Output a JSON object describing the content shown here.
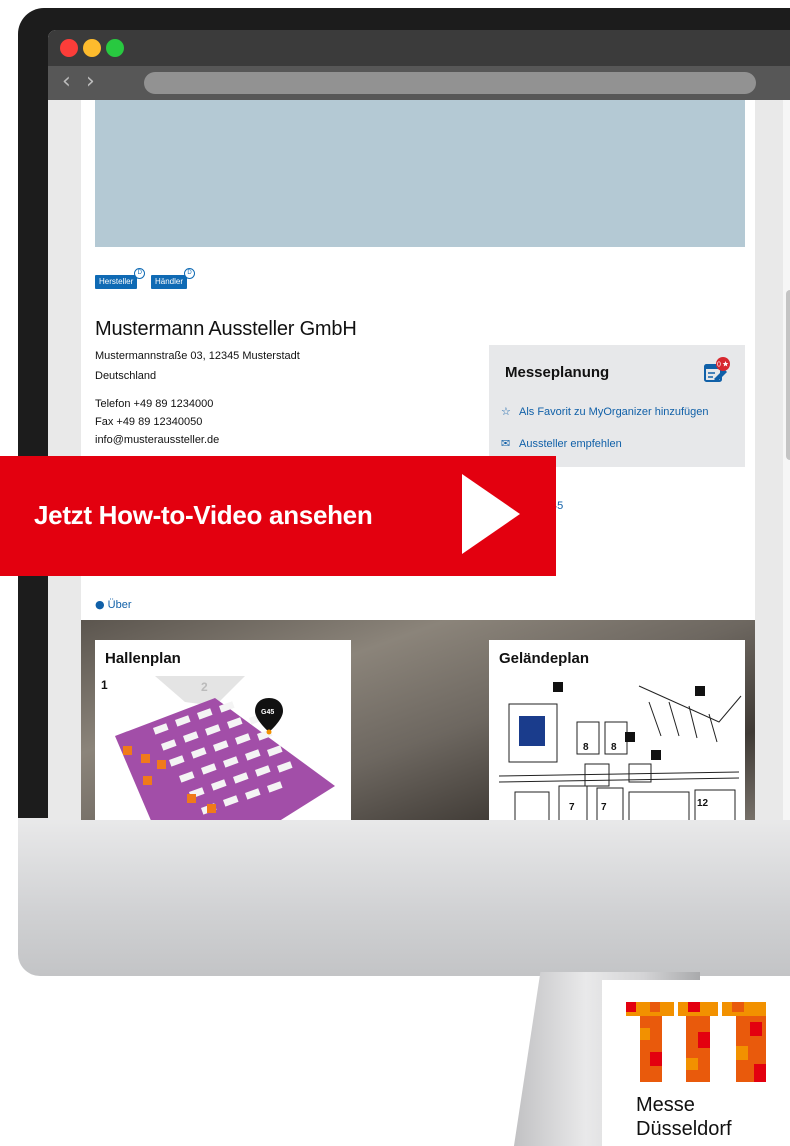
{
  "page": {
    "tags": [
      {
        "label": "Hersteller",
        "badge": "D"
      },
      {
        "label": "Händler",
        "badge": "D"
      }
    ],
    "company_name": "Mustermann Aussteller GmbH",
    "address_line1": "Mustermannstraße 03, 12345 Musterstadt",
    "address_line2": "Deutschland",
    "phone": "Telefon +49 89 1234000",
    "fax": "Fax +49 89 12340050",
    "email": "info@musteraussteller.de",
    "partial_stand": "45",
    "partial_link": "Über"
  },
  "planning": {
    "title": "Messeplanung",
    "badge": "0",
    "favorite_link": "Als Favorit zu MyOrganizer hinzufügen",
    "recommend_link": "Aussteller empfehlen",
    "favorite_icon": "star-outline-icon",
    "recommend_icon": "envelope-icon"
  },
  "maps": {
    "hall_title": "Hallenplan",
    "hall_number": "1",
    "hall_number_2": "2",
    "pin_label": "G45",
    "site_title": "Geländeplan"
  },
  "cta": {
    "text": "Jetzt How-to-Video ansehen"
  },
  "logo": {
    "line1": "Messe",
    "line2": "Düsseldorf",
    "color_orange": "#f29100",
    "color_red": "#e3000f"
  },
  "colors": {
    "tag_blue": "#0f6ab4",
    "link_blue": "#1060a8",
    "hero": "#b4c9d4",
    "cta_red": "#e3000f",
    "hall_purple": "#a24ea8"
  }
}
